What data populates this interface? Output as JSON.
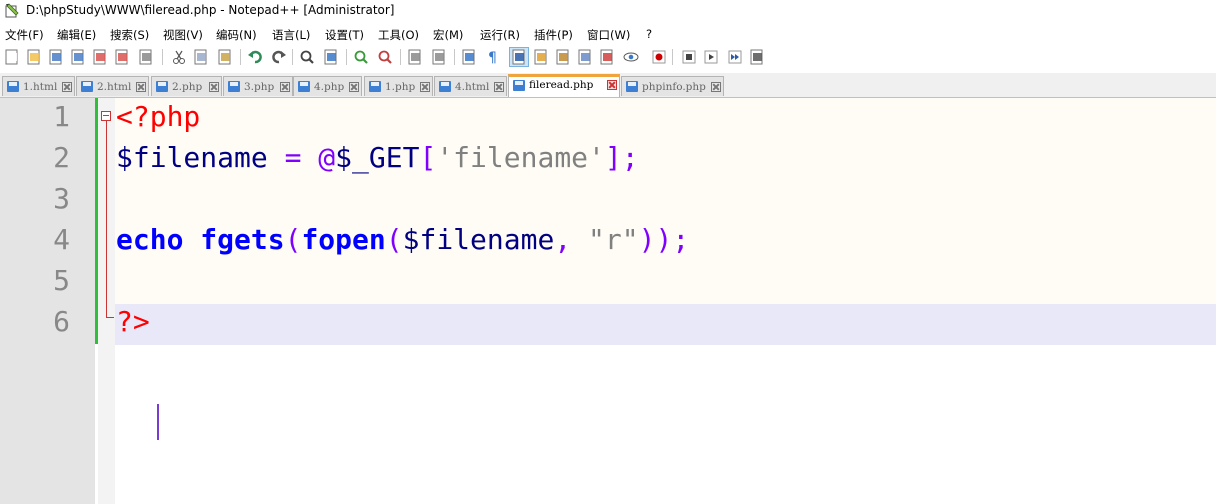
{
  "window": {
    "title": "D:\\phpStudy\\WWW\\fileread.php - Notepad++ [Administrator]"
  },
  "menu": {
    "items": [
      "文件(F)",
      "编辑(E)",
      "搜索(S)",
      "视图(V)",
      "编码(N)",
      "语言(L)",
      "设置(T)",
      "工具(O)",
      "宏(M)",
      "运行(R)",
      "插件(P)",
      "窗口(W)",
      "?"
    ]
  },
  "toolbar": {
    "buttons": [
      "new-file-icon",
      "open-file-icon",
      "save-icon",
      "save-all-icon",
      "close-icon",
      "close-all-icon",
      "print-icon",
      "cut-icon",
      "copy-icon",
      "paste-icon",
      "undo-icon",
      "redo-icon",
      "find-icon",
      "replace-icon",
      "zoom-in-icon",
      "zoom-out-icon",
      "sync-vertical-icon",
      "sync-horizontal-icon",
      "word-wrap-icon",
      "show-all-chars-icon",
      "indent-guide-icon",
      "user-lang-icon",
      "doc-map-icon",
      "function-list-icon",
      "folder-workspace-icon",
      "monitor-icon",
      "record-macro-icon",
      "stop-record-icon",
      "play-macro-icon",
      "run-macro-multiple-icon",
      "save-macro-icon"
    ]
  },
  "tabs": [
    {
      "label": "1.html"
    },
    {
      "label": "2.html"
    },
    {
      "label": "2.php"
    },
    {
      "label": "3.php"
    },
    {
      "label": "4.php"
    },
    {
      "label": "1.php"
    },
    {
      "label": "4.html"
    },
    {
      "label": "fileread.php",
      "active": true
    },
    {
      "label": "phpinfo.php"
    }
  ],
  "editor": {
    "line_numbers": [
      "1",
      "2",
      "3",
      "4",
      "5",
      "6"
    ],
    "lines": [
      [
        {
          "t": "<?php",
          "c": "tag"
        }
      ],
      [
        {
          "t": "$filename",
          "c": "var"
        },
        {
          "t": " ",
          "c": "plain"
        },
        {
          "t": "=",
          "c": "op"
        },
        {
          "t": " ",
          "c": "plain"
        },
        {
          "t": "@",
          "c": "op"
        },
        {
          "t": "$_GET",
          "c": "var"
        },
        {
          "t": "[",
          "c": "op"
        },
        {
          "t": "'filename'",
          "c": "str"
        },
        {
          "t": "];",
          "c": "op"
        }
      ],
      [],
      [
        {
          "t": "echo",
          "c": "kw"
        },
        {
          "t": " ",
          "c": "plain"
        },
        {
          "t": "fgets",
          "c": "kw"
        },
        {
          "t": "(",
          "c": "op"
        },
        {
          "t": "fopen",
          "c": "kw"
        },
        {
          "t": "(",
          "c": "op"
        },
        {
          "t": "$filename",
          "c": "var"
        },
        {
          "t": ",",
          "c": "op"
        },
        {
          "t": " ",
          "c": "plain"
        },
        {
          "t": "\"r\"",
          "c": "str"
        },
        {
          "t": "));",
          "c": "op"
        }
      ],
      [],
      [
        {
          "t": "?>",
          "c": "tag"
        }
      ]
    ],
    "current_line": 6
  },
  "colors": {
    "php_tag": "#ff0000",
    "variable": "#000080",
    "operator": "#8000ff",
    "string": "#808080",
    "keyword": "#0000ff",
    "change_marker": "#2fbf3a",
    "active_tab_accent": "#f0a43c"
  }
}
